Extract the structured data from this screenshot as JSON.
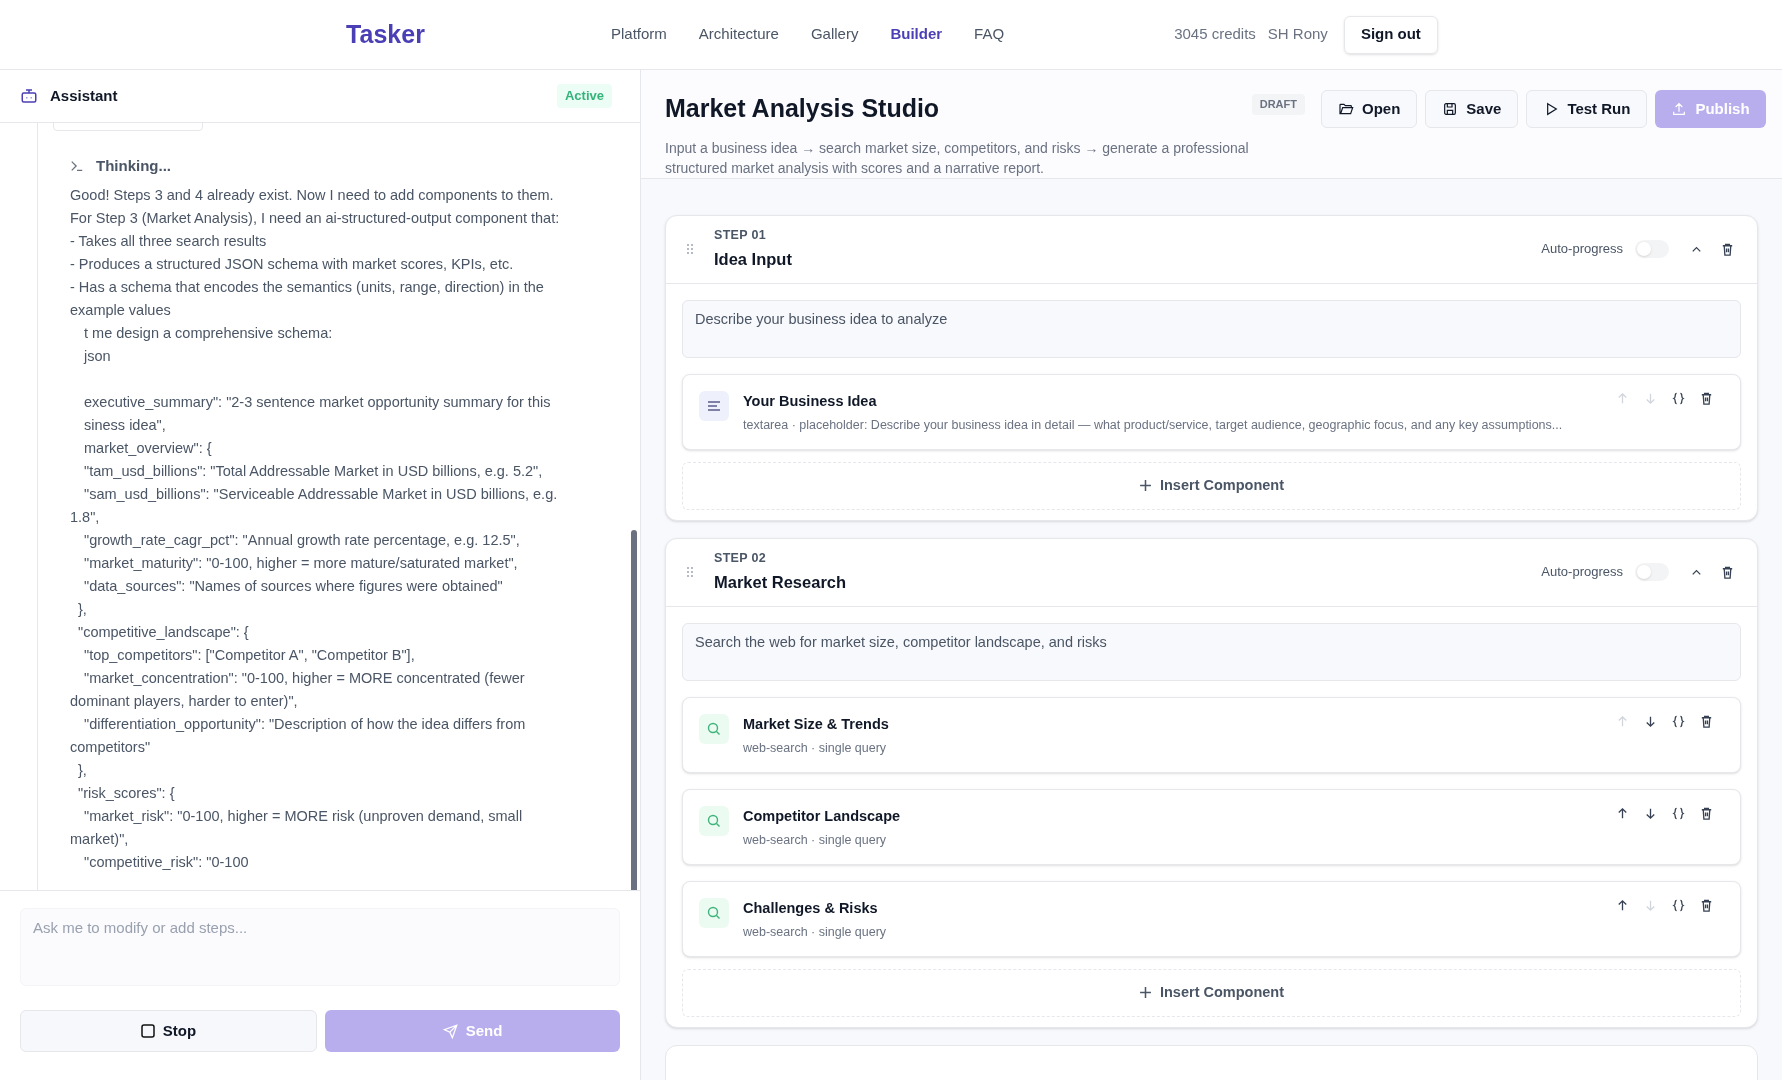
{
  "nav": {
    "logo": "Tasker",
    "links": [
      {
        "label": "Platform",
        "selected": false
      },
      {
        "label": "Architecture",
        "selected": false
      },
      {
        "label": "Gallery",
        "selected": false
      },
      {
        "label": "Builder",
        "selected": true
      },
      {
        "label": "FAQ",
        "selected": false
      }
    ],
    "credits": "3045 credits",
    "user": "SH Rony",
    "sign_out": "Sign out"
  },
  "assistant": {
    "title": "Assistant",
    "status": "Active",
    "thinking": "Thinking...",
    "lines": [
      {
        "kind": "prose",
        "text": "Good! Steps 3 and 4 already exist. Now I need to add components to them."
      },
      {
        "kind": "prose",
        "text": "For Step 3 (Market Analysis), I need an ai-structured-output component that:"
      },
      {
        "kind": "prose",
        "text": "- Takes all three search results"
      },
      {
        "kind": "prose",
        "text": "- Produces a structured JSON schema with market scores, KPIs, etc."
      },
      {
        "kind": "prose",
        "text": "- Has a schema that encodes the semantics (units, range, direction) in the example values"
      },
      {
        "kind": "inner",
        "text": "t me design a comprehensive schema:"
      },
      {
        "kind": "inner",
        "text": "json"
      },
      {
        "kind": "blank"
      },
      {
        "kind": "inner",
        "text": "executive_summary\": \"2-3 sentence market opportunity summary for this"
      },
      {
        "kind": "inner",
        "text": "siness idea\","
      },
      {
        "kind": "inner",
        "text": "market_overview\": {"
      },
      {
        "kind": "inner",
        "text": "\"tam_usd_billions\": \"Total Addressable Market in USD billions, e.g. 5.2\","
      },
      {
        "kind": "inner",
        "text": "\"sam_usd_billions\": \"Serviceable Addressable Market in USD billions, e.g. 1.8\","
      },
      {
        "kind": "inner",
        "text": "\"growth_rate_cagr_pct\": \"Annual growth rate percentage, e.g. 12.5\","
      },
      {
        "kind": "inner",
        "text": "\"market_maturity\": \"0-100, higher = more mature/saturated market\","
      },
      {
        "kind": "inner",
        "text": "\"data_sources\": \"Names of sources where figures were obtained\""
      },
      {
        "kind": "outer",
        "text": "},"
      },
      {
        "kind": "outer",
        "text": "\"competitive_landscape\": {"
      },
      {
        "kind": "inner",
        "text": "\"top_competitors\": [\"Competitor A\", \"Competitor B\"],"
      },
      {
        "kind": "inner",
        "text": "\"market_concentration\": \"0-100, higher = MORE concentrated (fewer dominant players, harder to enter)\","
      },
      {
        "kind": "inner",
        "text": "\"differentiation_opportunity\": \"Description of how the idea differs from competitors\""
      },
      {
        "kind": "outer",
        "text": "},"
      },
      {
        "kind": "outer",
        "text": "\"risk_scores\": {"
      },
      {
        "kind": "inner",
        "text": "\"market_risk\": \"0-100, higher = MORE risk (unproven demand, small market)\","
      },
      {
        "kind": "inner",
        "text": "\"competitive_risk\": \"0-100"
      }
    ],
    "input": {
      "placeholder": "Ask me to modify or add steps..."
    },
    "stop": "Stop",
    "send": {
      "label": "Send",
      "disabled": true
    }
  },
  "studio": {
    "title": "Market Analysis Studio",
    "badge": "DRAFT",
    "description": "Input a business idea → search market size, competitors, and risks → generate a professional structured market analysis with scores and a narrative report.",
    "actions": [
      {
        "kind": "open",
        "label": "Open",
        "primary": false
      },
      {
        "kind": "save",
        "label": "Save",
        "primary": false
      },
      {
        "kind": "run",
        "label": "Test Run",
        "primary": false
      },
      {
        "kind": "publish",
        "label": "Publish",
        "primary": true
      }
    ],
    "steps": [
      {
        "number": "STEP 01",
        "title": "Idea Input",
        "auto_label": "Auto-progress",
        "insert_label": "Insert Component",
        "auto_progress": false,
        "description": "Describe your business idea to analyze",
        "components": [
          {
            "kind": "textarea",
            "title": "Your Business Idea",
            "meta": "textarea · placeholder: Describe your business idea in detail — what product/service, target audience, geographic focus, and any key assumptions...",
            "up_disabled": true,
            "down_disabled": true
          }
        ]
      },
      {
        "number": "STEP 02",
        "title": "Market Research",
        "auto_label": "Auto-progress",
        "insert_label": "Insert Component",
        "auto_progress": false,
        "description": "Search the web for market size, competitor landscape, and risks",
        "components": [
          {
            "kind": "search",
            "title": "Market Size & Trends",
            "meta": "web-search · single query",
            "up_disabled": true,
            "down_disabled": false
          },
          {
            "kind": "search",
            "title": "Competitor Landscape",
            "meta": "web-search · single query",
            "up_disabled": false,
            "down_disabled": false
          },
          {
            "kind": "search",
            "title": "Challenges & Risks",
            "meta": "web-search · single query",
            "up_disabled": false,
            "down_disabled": true
          }
        ]
      }
    ]
  }
}
